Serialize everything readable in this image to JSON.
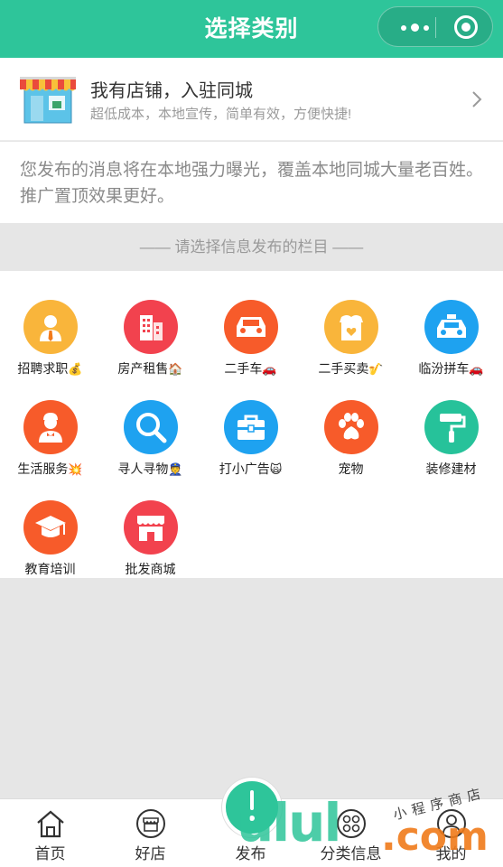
{
  "navbar": {
    "title": "选择类别",
    "capsule_menu_icon": "more-dots-icon",
    "capsule_close_icon": "target-icon"
  },
  "shop_banner": {
    "title": "我有店铺，入驻同城",
    "subtitle": "超低成本，本地宣传，简单有效，方便快捷!",
    "icon": "storefront-icon",
    "arrow_icon": "chevron-right-icon"
  },
  "notice": {
    "text": "您发布的消息将在本地强力曝光，覆盖本地同城大量老百姓。推广置顶效果更好。"
  },
  "section_header": {
    "text": "—— 请选择信息发布的栏目 ——"
  },
  "categories": [
    {
      "label": "招聘求职",
      "emoji": "💰",
      "icon": "person-tie-icon",
      "color": "#f9b53b"
    },
    {
      "label": "房产租售",
      "emoji": "🏠",
      "icon": "building-icon",
      "color": "#f2424e"
    },
    {
      "label": "二手车",
      "emoji": "🚗",
      "icon": "car-icon",
      "color": "#f75b2a"
    },
    {
      "label": "二手买卖",
      "emoji": "🎷",
      "icon": "gift-box-icon",
      "color": "#f9b53b"
    },
    {
      "label": "临汾拼车",
      "emoji": "🚗",
      "icon": "taxi-icon",
      "color": "#1ea2f0"
    },
    {
      "label": "生活服务",
      "emoji": "💥",
      "icon": "waiter-icon",
      "color": "#f75b2a"
    },
    {
      "label": "寻人寻物",
      "emoji": "👮",
      "icon": "magnifier-icon",
      "color": "#1ea2f0"
    },
    {
      "label": "打小广告",
      "emoji": "🙀",
      "icon": "briefcase-icon",
      "color": "#1ea2f0"
    },
    {
      "label": "宠物",
      "emoji": "",
      "icon": "paw-icon",
      "color": "#f75b2a"
    },
    {
      "label": "装修建材",
      "emoji": "",
      "icon": "paint-roller-icon",
      "color": "#26c29a"
    },
    {
      "label": "教育培训",
      "emoji": "",
      "icon": "graduation-cap-icon",
      "color": "#f75b2a"
    },
    {
      "label": "批发商城",
      "emoji": "",
      "icon": "shop-awning-icon",
      "color": "#f2424e"
    }
  ],
  "tabbar": {
    "tabs": [
      {
        "label": "首页",
        "icon": "home-icon"
      },
      {
        "label": "好店",
        "icon": "store-icon"
      },
      {
        "label": "发布",
        "icon": "publish-icon"
      },
      {
        "label": "分类信息",
        "icon": "category-icon"
      },
      {
        "label": "我的",
        "icon": "user-icon"
      }
    ]
  },
  "watermark": {
    "main": "ulul",
    "suffix": ".com",
    "script": "小程序商店"
  },
  "colors": {
    "brand": "#2ec59a",
    "text_primary": "#333333",
    "text_muted": "#9a9a9a"
  }
}
